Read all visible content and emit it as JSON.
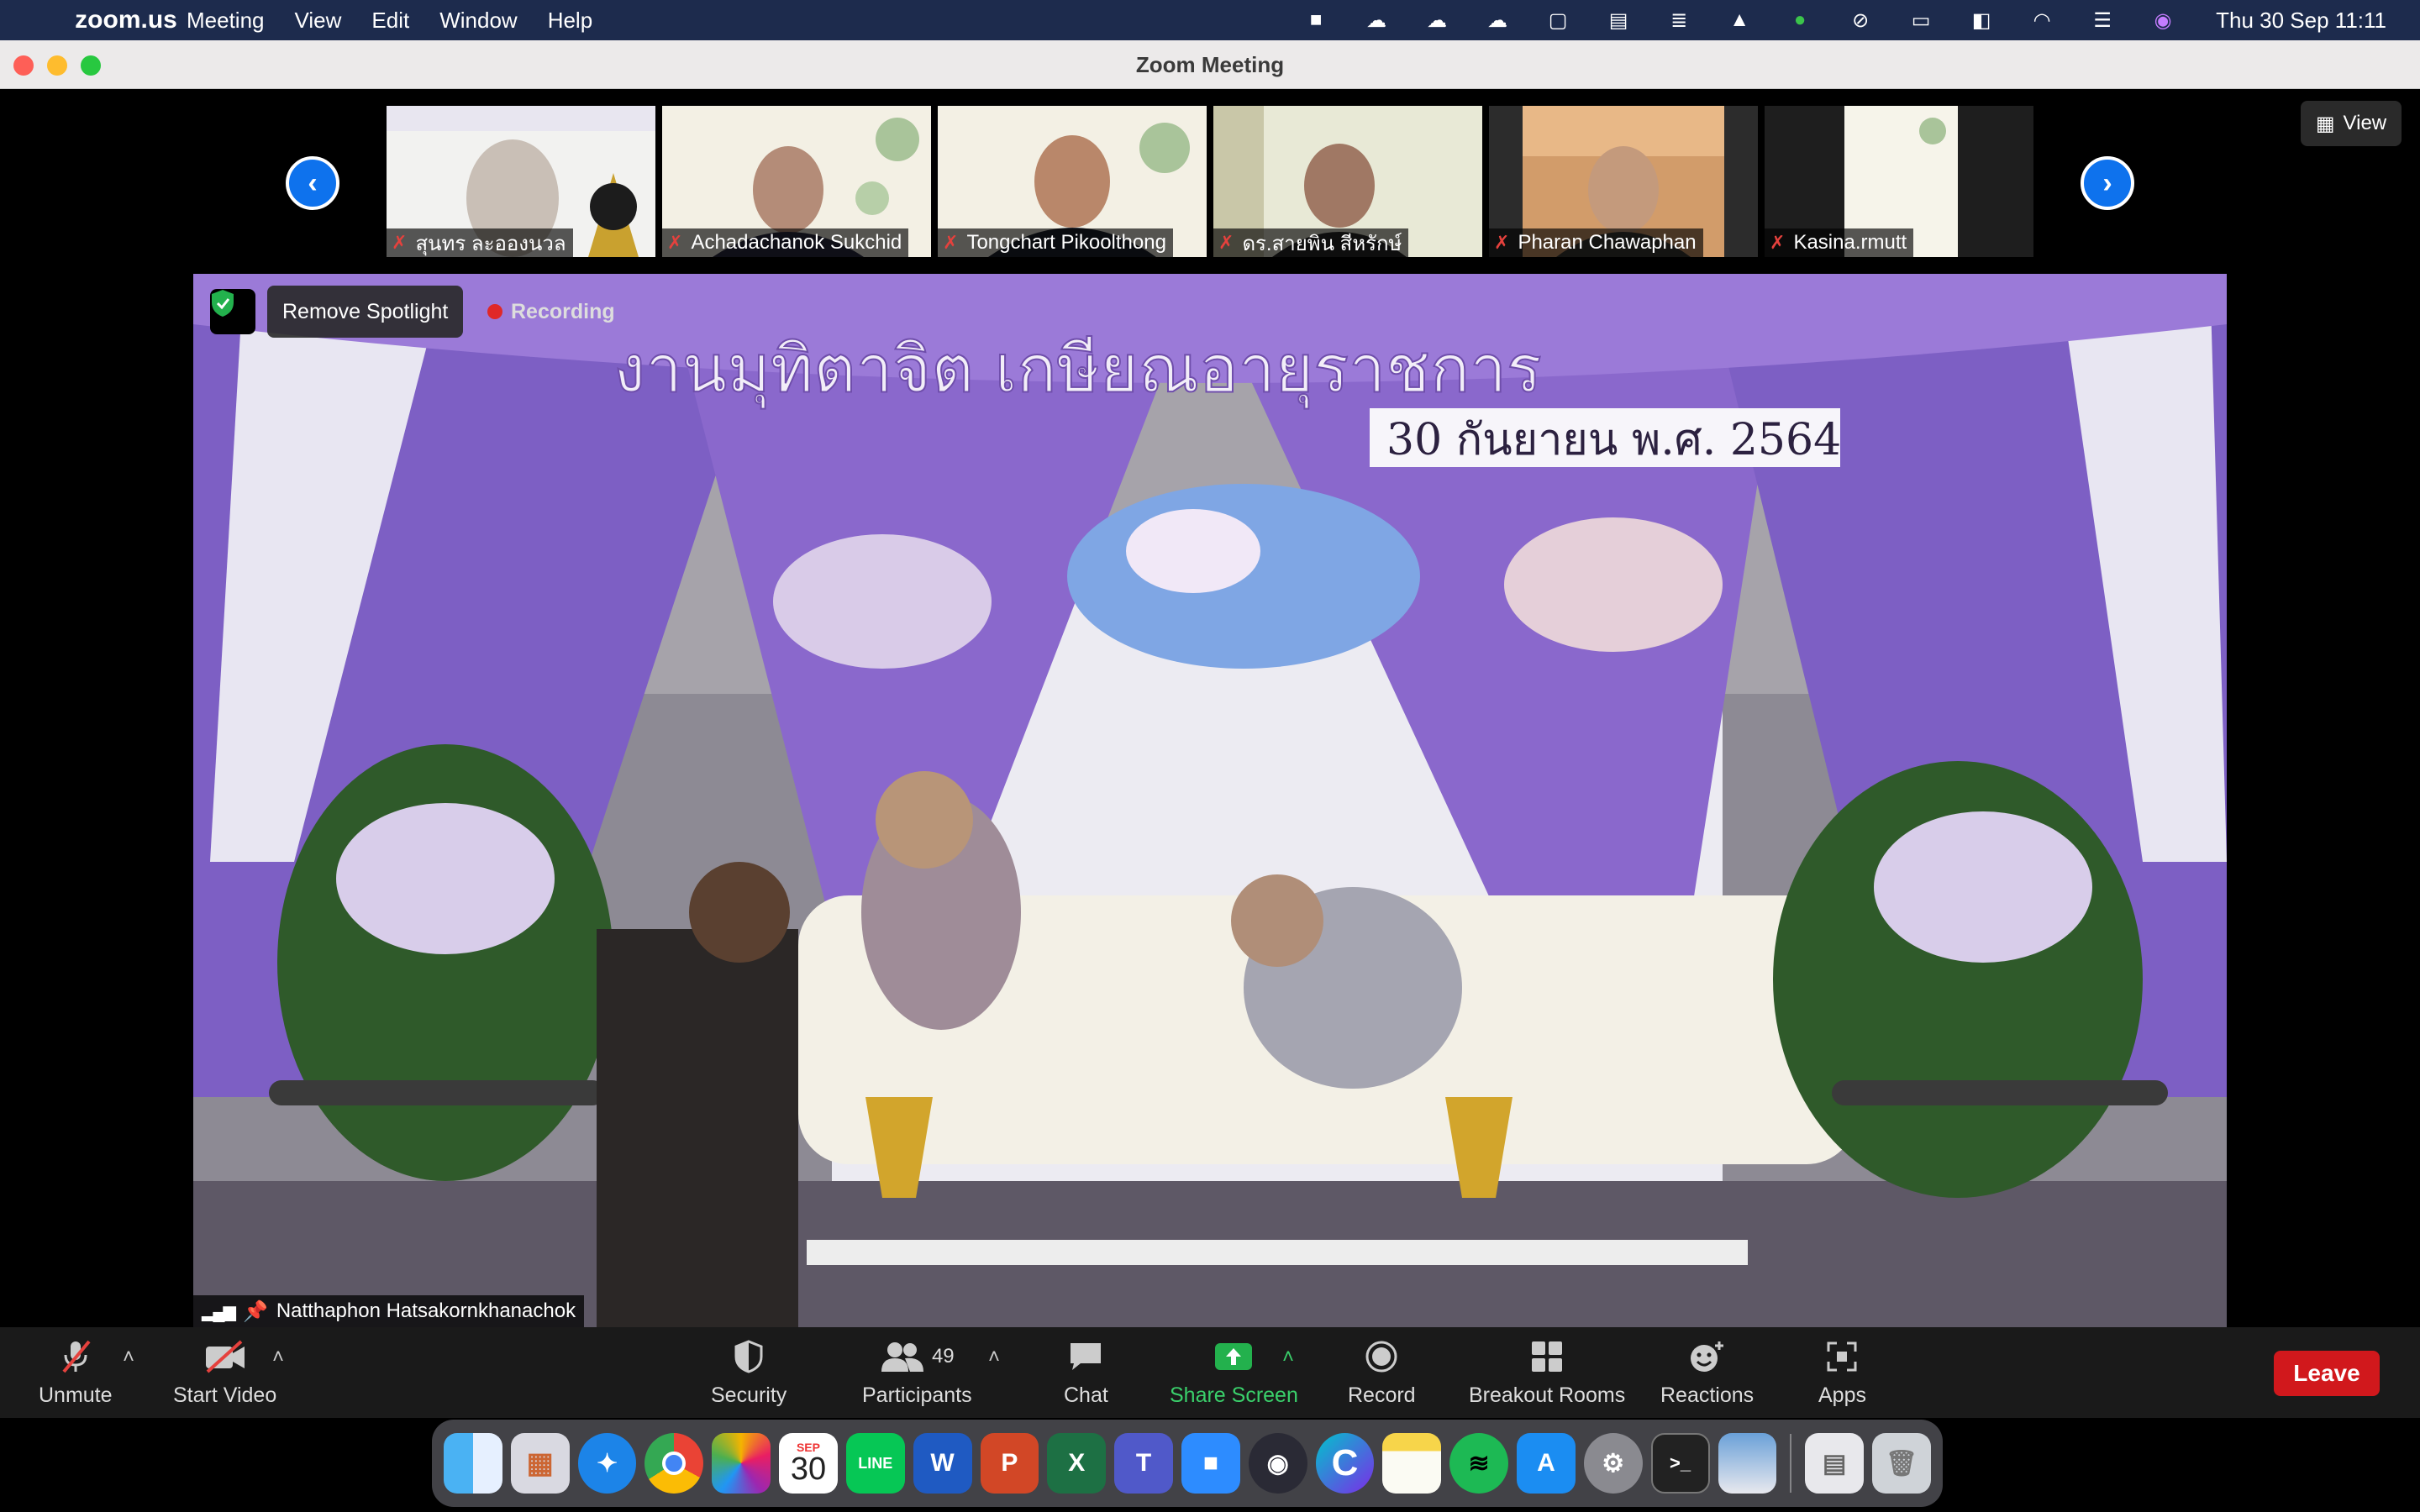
{
  "menubar": {
    "app_name": "zoom.us",
    "menus": [
      "Meeting",
      "View",
      "Edit",
      "Window",
      "Help"
    ],
    "clock": "Thu 30 Sep  11:11",
    "status_icons": [
      "zoom-camera-icon",
      "cloud-icon",
      "cloud-icon",
      "cloud-icon",
      "window-icon",
      "layout-icon",
      "stack-icon",
      "drive-icon",
      "line-icon",
      "mute-icon",
      "battery-icon",
      "notion-icon",
      "wifi-icon",
      "control-center-icon",
      "siri-icon"
    ]
  },
  "window": {
    "title": "Zoom Meeting"
  },
  "gallery": {
    "participants": [
      {
        "name": "สุนทร ละอองนวล",
        "muted": true
      },
      {
        "name": "Achadachanok Sukchid",
        "muted": true
      },
      {
        "name": "Tongchart Pikoolthong",
        "muted": true
      },
      {
        "name": "ดร.สายพิน สีหรักษ์",
        "muted": true
      },
      {
        "name": "Pharan Chawaphan",
        "muted": true
      },
      {
        "name": "Kasina.rmutt",
        "muted": true
      }
    ],
    "view_label": "View"
  },
  "spotlight": {
    "remove_label": "Remove Spotlight",
    "recording_label": "Recording",
    "speaker_name": "Natthaphon Hatsakornkhanachok",
    "banner_text": "งานมุทิตาจิต เกษียณอายุราชการ",
    "banner_date": "30 กันยายน พ.ศ. 2564"
  },
  "toolbar": {
    "unmute": "Unmute",
    "start_video": "Start Video",
    "security": "Security",
    "participants": "Participants",
    "participants_count": "49",
    "chat": "Chat",
    "share_screen": "Share Screen",
    "record": "Record",
    "breakout": "Breakout Rooms",
    "reactions": "Reactions",
    "apps": "Apps",
    "leave": "Leave"
  },
  "dock": {
    "calendar_month": "SEP",
    "calendar_day": "30",
    "apps": [
      "Finder",
      "Launchpad",
      "Safari",
      "Chrome",
      "Photos",
      "Calendar",
      "LINE",
      "Word",
      "PowerPoint",
      "Excel",
      "Teams",
      "Zoom",
      "OBS",
      "Canva",
      "Notes",
      "Spotify",
      "App Store",
      "System Preferences",
      "Terminal",
      "Preview",
      "Documents",
      "Trash"
    ]
  }
}
